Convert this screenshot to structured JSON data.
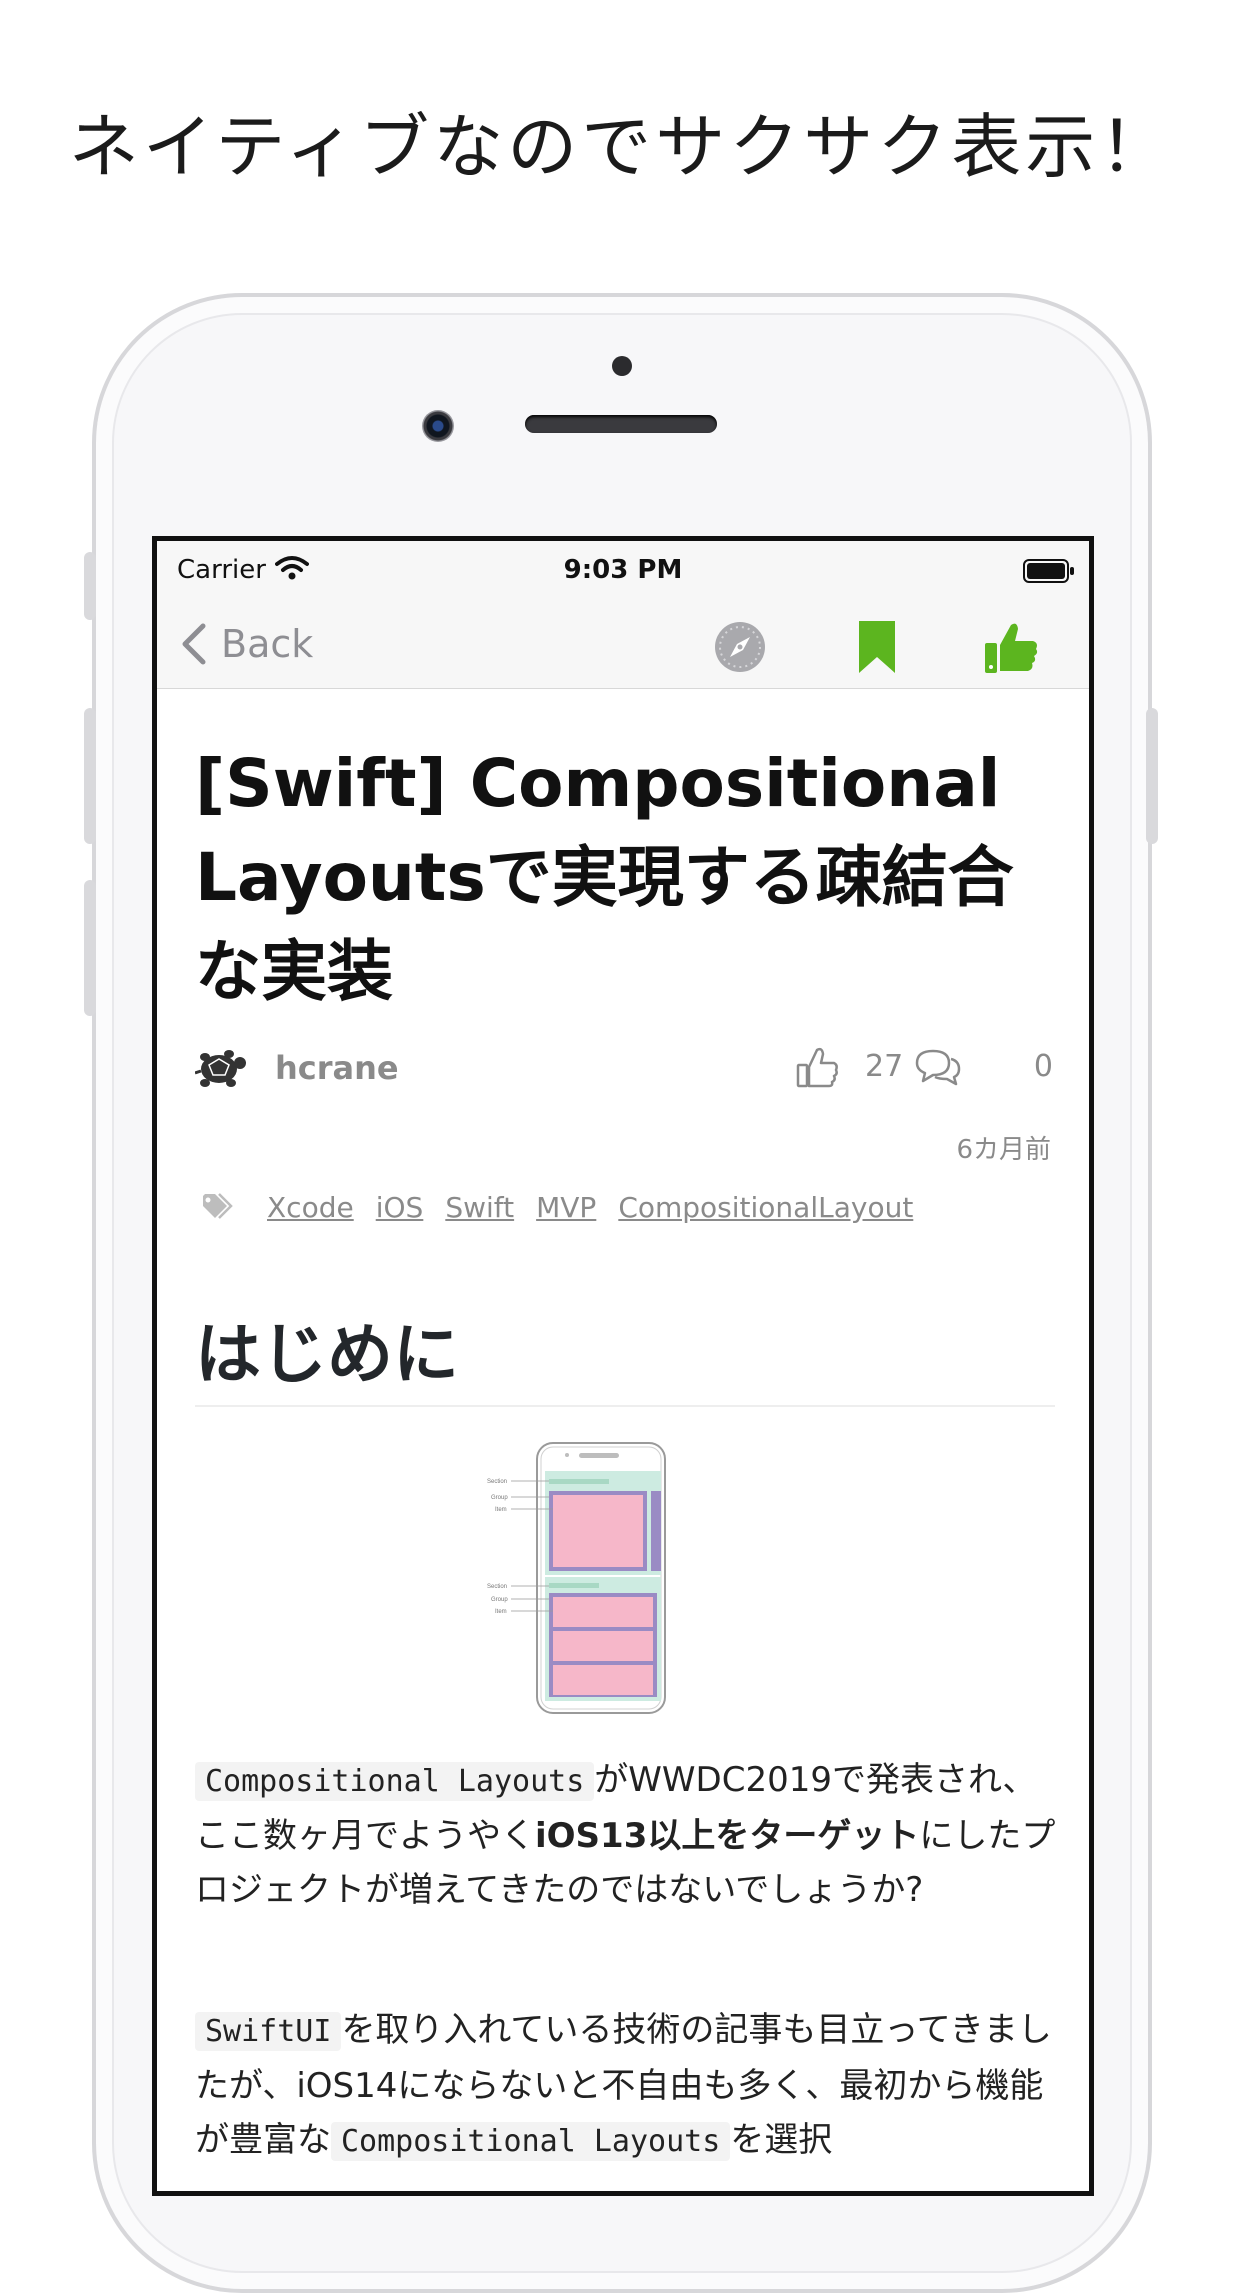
{
  "promo": {
    "caption": "ネイティブなのでサクサク表示！"
  },
  "statusbar": {
    "carrier": "Carrier",
    "time": "9:03 PM"
  },
  "navbar": {
    "back_label": "Back"
  },
  "article": {
    "title": "[Swift] Compositional Layoutsで実現する疎結合な実装",
    "author": "hcrane",
    "like_count": "27",
    "comment_count": "0",
    "posted": "6カ月前",
    "tags": [
      "Xcode",
      "iOS",
      "Swift",
      "MVP",
      "CompositionalLayout"
    ],
    "section_heading": "はじめに",
    "p1": {
      "code1": "Compositional Layouts",
      "text1": "がWWDC2019で発表され、ここ数ヶ月でようやく",
      "bold1": "iOS13以上をターゲット",
      "text2": "にしたプロジェクトが増えてきたのではないでしょうか?"
    },
    "p2": {
      "code1": "SwiftUI",
      "text1": "を取り入れている技術の記事も目立ってきましたが、iOS14にならないと不自由も多く、最初から機能が豊富な",
      "code2": "Compositional Layouts",
      "text2": "を選択"
    },
    "diagram_labels": {
      "section": "Section",
      "group": "Group",
      "item": "Item"
    }
  },
  "colors": {
    "accent_green": "#5cb51f",
    "gray": "#8a8a8a"
  }
}
